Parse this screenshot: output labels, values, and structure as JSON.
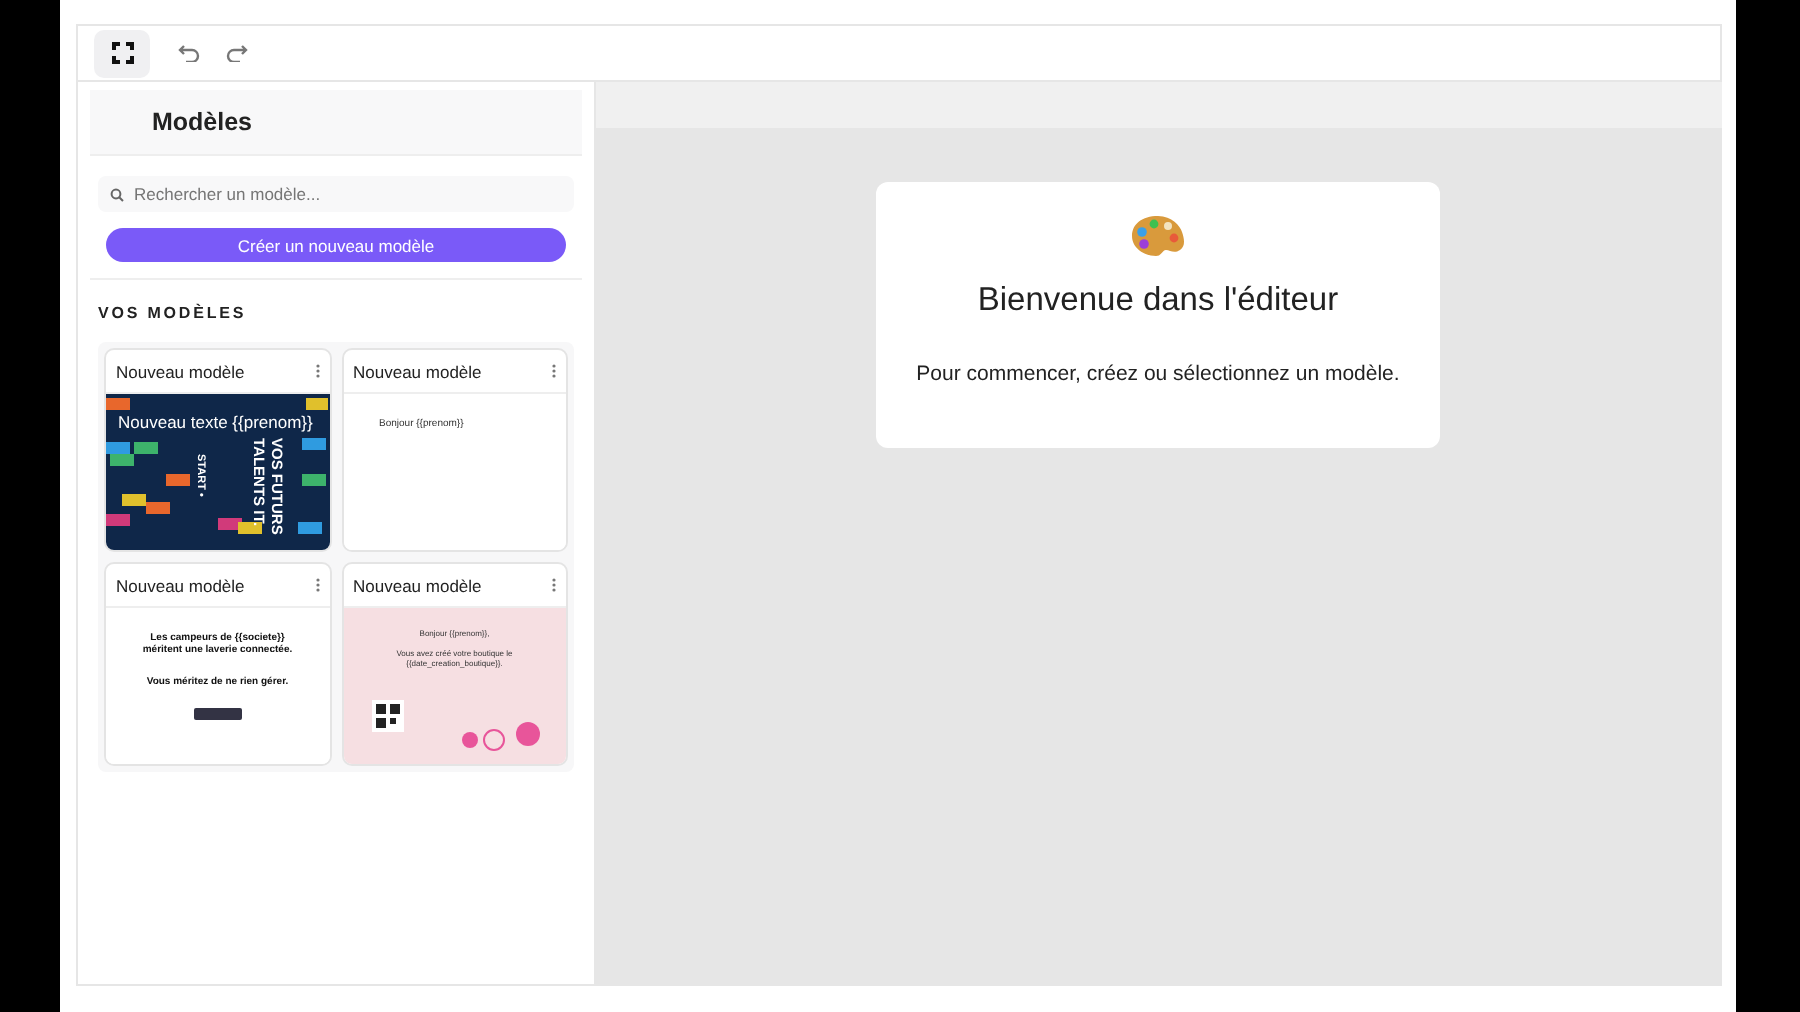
{
  "toolbar": {
    "buttons": [
      {
        "kind": "fullscreen",
        "selected": true
      },
      {
        "kind": "undo",
        "selected": false
      },
      {
        "kind": "redo",
        "selected": false
      }
    ]
  },
  "sidebar": {
    "title": "Modèles",
    "search": {
      "placeholder": "Rechercher un modèle..."
    },
    "create_button": "Créer un nouveau modèle",
    "section_title": "VOS MODÈLES",
    "templates": [
      {
        "name": "Nouveau modèle",
        "preview": {
          "kind": "tetris",
          "texts": [
            "Nouveau texte {{prenom}}",
            "VOS FUTURS TALENTS IT.",
            "START •"
          ]
        }
      },
      {
        "name": "Nouveau modèle",
        "preview": {
          "kind": "letter",
          "texts": [
            "Bonjour {{prenom}}"
          ]
        }
      },
      {
        "name": "Nouveau modèle",
        "preview": {
          "kind": "laundry",
          "texts": [
            "Les campeurs de {{societe}} méritent une laverie connectée.",
            "Vous méritez de ne rien gérer."
          ]
        }
      },
      {
        "name": "Nouveau modèle",
        "preview": {
          "kind": "pink",
          "texts": [
            "Bonjour {{prenom}},",
            "Vous avez créé votre boutique le {{date_creation_boutique}}."
          ]
        }
      }
    ]
  },
  "welcome": {
    "title": "Bienvenue dans l'éditeur",
    "message": "Pour commencer, créez ou sélectionnez un modèle."
  }
}
